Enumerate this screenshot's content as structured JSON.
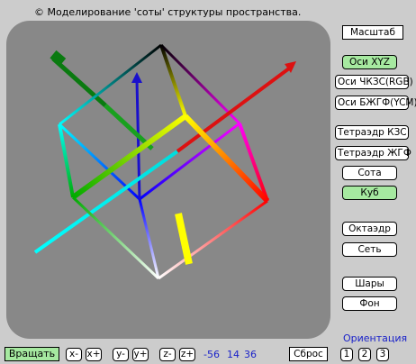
{
  "title": "© Моделирование 'соты' структуры пространства.",
  "right_panel": {
    "scale_label": "Масштаб",
    "axes_xyz": "Оси XYZ",
    "axes_rgb": "Оси ЧКЗС(RGB)",
    "axes_ycm": "Оси БЖГФ(YCM)",
    "tetra_kzs": "Тетраэдр КЗС",
    "tetra_zhgf": "Тетраэдр ЖГФ",
    "honeycomb": "Сота",
    "cube": "Куб",
    "octahedron": "Октаэдр",
    "grid": "Сеть",
    "balls": "Шары",
    "background": "Фон"
  },
  "bottom_bar": {
    "rotate": "Вращать",
    "x_minus": "x-",
    "x_plus": "x+",
    "y_minus": "y-",
    "y_plus": "y+",
    "z_minus": "z-",
    "z_plus": "z+",
    "angle_x": "-56",
    "angle_y": "14",
    "angle_z": "36",
    "reset": "Сброс",
    "orientation_label": "Ориентация",
    "orient_1": "1",
    "orient_2": "2",
    "orient_3": "3"
  },
  "active": [
    "axes_xyz",
    "cube",
    "rotate"
  ],
  "colors": {
    "viewport_bg": "#888888",
    "active_button": "#a6e9a0",
    "angle_text": "#1a22c9",
    "axis_x": "#dd1111",
    "axis_y": "#1a10cc",
    "axis_z": "#0a7a10"
  }
}
